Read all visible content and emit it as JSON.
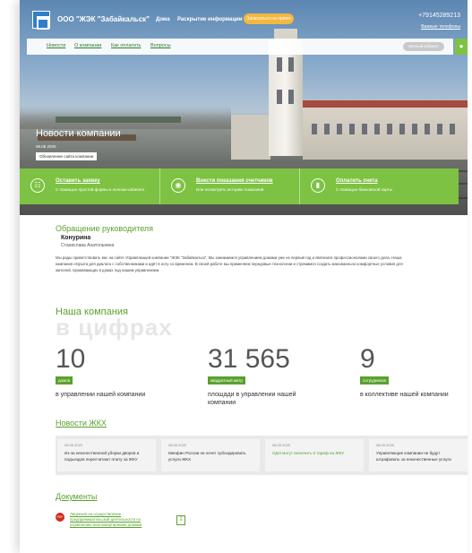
{
  "header": {
    "company_name": "ООО \"ЖЭК \"Забайкальск\"",
    "nav": [
      "Дома",
      "Раскрытие информации"
    ],
    "cta_button": "Записаться на прием",
    "phone": "+79145289213",
    "phone_sub": "Важные телефоны"
  },
  "navbar": {
    "items": [
      "Новости",
      "О компании",
      "Как оплатить",
      "Вопросы"
    ],
    "cabinet": "Личный кабинет",
    "accessibility_icon": "eye-icon"
  },
  "hero": {
    "title": "Новости компании",
    "date": "06.05  2020",
    "pill": "Обновление сайта компании"
  },
  "actions": [
    {
      "icon": "form-icon",
      "title": "Оставить заявку",
      "subtitle": "С помощью простой формы в личном кабинете"
    },
    {
      "icon": "meter-icon",
      "title": "Внести показания счетчиков",
      "subtitle": "Или посмотреть историю показаний"
    },
    {
      "icon": "card-icon",
      "title": "Оплатить счета",
      "subtitle": "С помощью банковской карты"
    }
  ],
  "leader": {
    "heading": "Обращение руководителя",
    "name": "Конурина",
    "patronymic": "Станислава Анатольевна",
    "text": "Мы рады приветствовать вас на сайте Управляющей компании \"ЖЭК \"Забайкальск\". Мы занимаемся управлением домами уже не первый год и являемся профессионалами своего дела. Наша компания открыта для диалога с собственниками и идёт в ногу со временем. В своей работе мы применяем передовые технологии и стремимся создать максимально комфортные условия для жителей, проживающих в домах под нашим управлением."
  },
  "company": {
    "heading": "Наша компания",
    "big": "в цифрах",
    "stats": [
      {
        "number": "10",
        "badge": "домов",
        "desc": "в управлении нашей компании"
      },
      {
        "number": "31 565",
        "badge": "квадратный метр",
        "desc": "площади в управлении нашей компании"
      },
      {
        "number": "9",
        "badge": "сотрудников",
        "desc": "в коллективе нашей компании"
      }
    ]
  },
  "zhkh": {
    "heading": "Новости ЖКХ",
    "items": [
      {
        "date": "08.05  2020",
        "text": "Из-за некачественной уборки дворов и подъездов пересчитают плату за ЖКУ"
      },
      {
        "date": "08.05  2020",
        "text": "Минфин России не хочет субсидировать услуги ЖКХ"
      },
      {
        "date": "08.05  2020",
        "text": "ОДН могут включить в тариф на ЖКУ"
      },
      {
        "date": "08.05  2020",
        "text": "Управляющие компании не будут штрафовать за некачественные услуги"
      }
    ]
  },
  "docs": {
    "heading": "Документы",
    "icon_label": "PDF",
    "link": "Лицензия на осуществление предпринимательской деятельности по управлению многоквартирными домами",
    "download_icon": "download-icon"
  },
  "colors": {
    "accent": "#7dc242",
    "accent_text": "#5aa12e",
    "cta": "#f4b740",
    "pdf": "#d12b1f"
  }
}
